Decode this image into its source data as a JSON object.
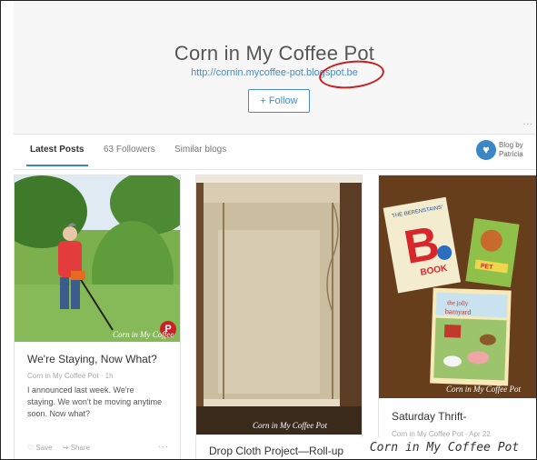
{
  "header": {
    "title": "Corn in My Coffee Pot",
    "url": "http://cornin.mycoffee-pot.blogspot.be",
    "follow_label": "+ Follow",
    "dots": "..."
  },
  "tabs": {
    "latest": "Latest Posts",
    "followers": "63 Followers",
    "similar": "Similar blogs"
  },
  "blog_by": {
    "line1": "Blog by",
    "line2": "Patricia"
  },
  "cards": [
    {
      "title": "We're Staying, Now What?",
      "meta": "Corn in My Coffee Pot · 1h",
      "excerpt": "I announced last week. We're staying. We won't be moving anytime soon.  Now what?",
      "save_label": "Save",
      "share_label": "Share",
      "dots": "···",
      "watermark": "Corn in My Coffee"
    },
    {
      "title": "Drop Cloth Project—Roll-up",
      "watermark": "Corn in My Coffee Pot"
    },
    {
      "title": "Saturday Thrift-",
      "meta": "Corn in My Coffee Pot · Apr 22",
      "watermark": "Corn in My Coffee Pot",
      "books": [
        "The Berenstains' B Book",
        "Pet Friends",
        "The Jolly Barnyard"
      ]
    }
  ],
  "watermark": "Corn in My Coffee Pot"
}
